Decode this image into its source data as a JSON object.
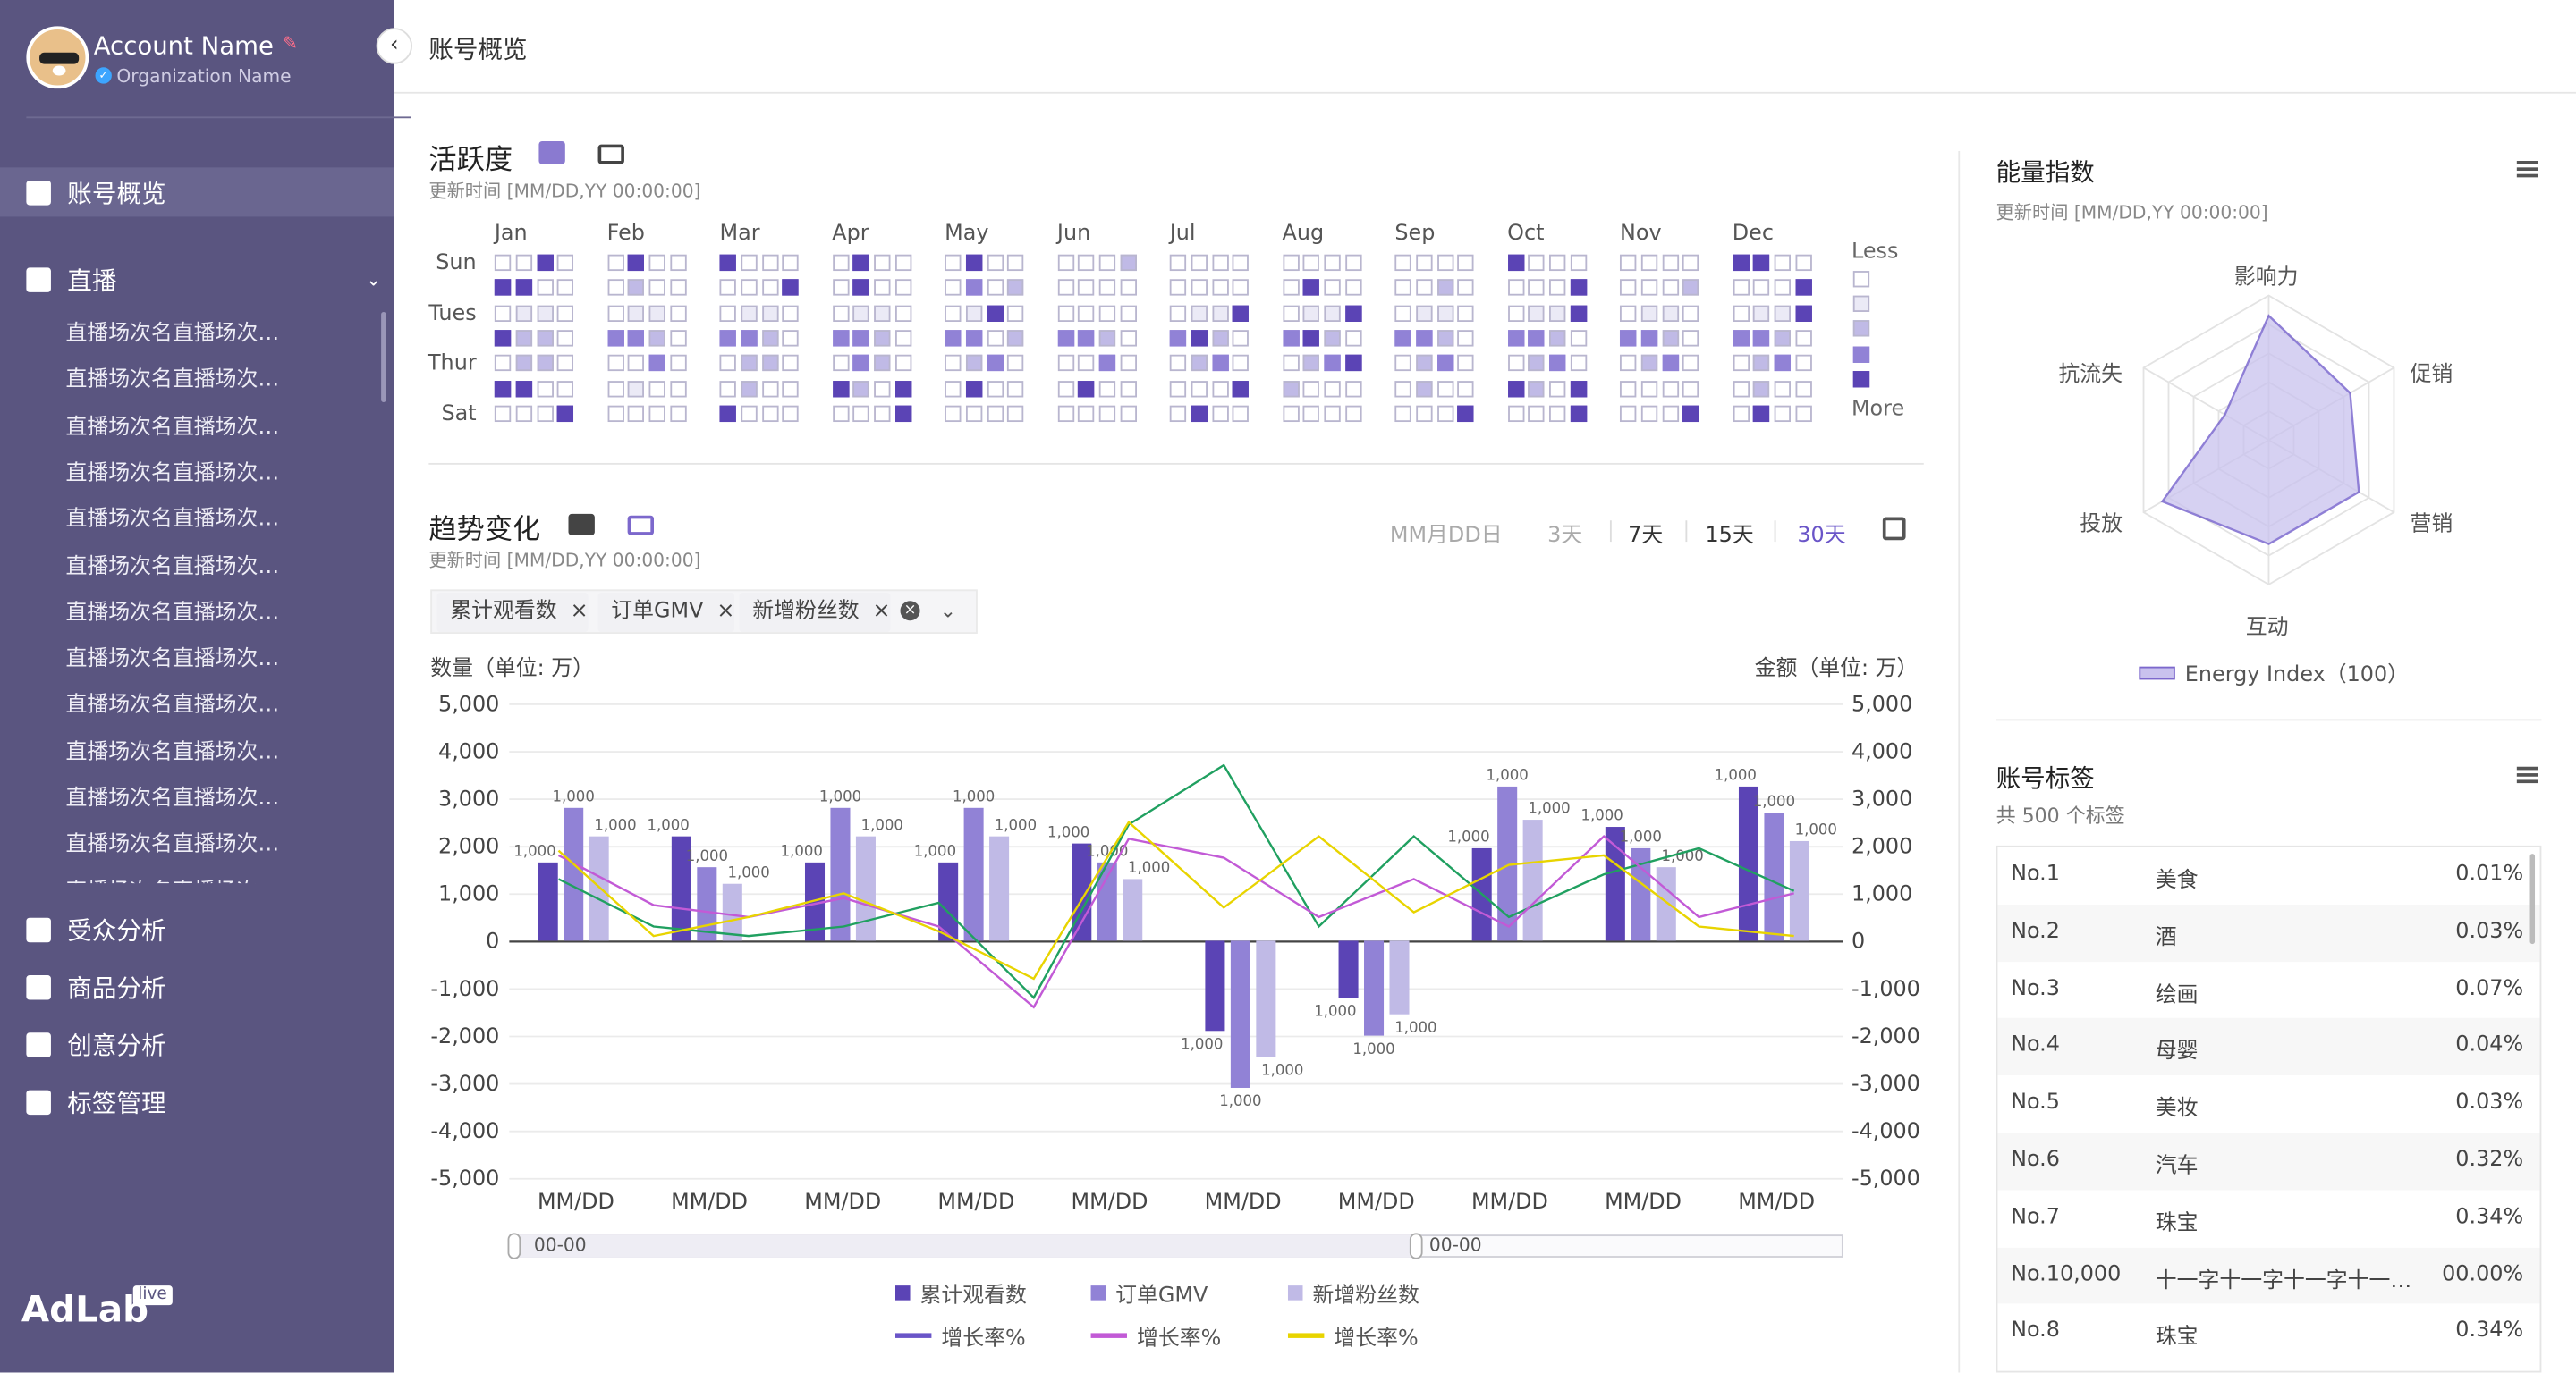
{
  "app": {
    "logo": "AdLab",
    "logo_badge": "live"
  },
  "account": {
    "name": "Account Name",
    "org": "Organization Name"
  },
  "header": {
    "title": "账号概览"
  },
  "nav": {
    "overview": "账号概览",
    "live": "直播",
    "live_items": [
      "直播场次名直播场次…",
      "直播场次名直播场次…",
      "直播场次名直播场次…",
      "直播场次名直播场次…",
      "直播场次名直播场次…",
      "直播场次名直播场次…",
      "直播场次名直播场次…",
      "直播场次名直播场次…",
      "直播场次名直播场次…",
      "直播场次名直播场次…",
      "直播场次名直播场次…",
      "直播场次名直播场次…",
      "直播场次名直播场次…"
    ],
    "audience": "受众分析",
    "product": "商品分析",
    "creative": "创意分析",
    "tags": "标签管理"
  },
  "activity": {
    "title": "活跃度",
    "updated": "更新时间 [MM/DD,YY 00:00:00]",
    "months": [
      "Jan",
      "Feb",
      "Mar",
      "Apr",
      "May",
      "Jun",
      "Jul",
      "Aug",
      "Sep",
      "Oct",
      "Nov",
      "Dec"
    ],
    "days": [
      "Sun",
      "Tues",
      "Thur",
      "Sat"
    ],
    "legend_less": "Less",
    "legend_more": "More",
    "level_colors": [
      "#ffffff",
      "#ebeaf6",
      "#c0bae6",
      "#9182d6",
      "#5b44b5"
    ],
    "levels": [
      [
        [
          0,
          0,
          4,
          0
        ],
        [
          4,
          4,
          0,
          0
        ],
        [
          0,
          1,
          1,
          0
        ],
        [
          4,
          2,
          2,
          0
        ],
        [
          0,
          2,
          2,
          0
        ],
        [
          4,
          4,
          0,
          0
        ],
        [
          0,
          0,
          0,
          4
        ]
      ],
      [
        [
          0,
          4,
          0,
          0
        ],
        [
          0,
          2,
          0,
          0
        ],
        [
          0,
          1,
          1,
          0
        ],
        [
          3,
          3,
          2,
          0
        ],
        [
          0,
          0,
          3,
          0
        ],
        [
          0,
          1,
          0,
          0
        ],
        [
          0,
          0,
          0,
          0
        ]
      ],
      [
        [
          4,
          0,
          0,
          0
        ],
        [
          0,
          0,
          0,
          4
        ],
        [
          0,
          1,
          1,
          0
        ],
        [
          3,
          3,
          2,
          0
        ],
        [
          0,
          2,
          2,
          0
        ],
        [
          0,
          2,
          0,
          0
        ],
        [
          4,
          0,
          0,
          0
        ]
      ],
      [
        [
          0,
          4,
          0,
          0
        ],
        [
          0,
          4,
          0,
          0
        ],
        [
          0,
          1,
          1,
          0
        ],
        [
          3,
          3,
          2,
          0
        ],
        [
          0,
          3,
          2,
          0
        ],
        [
          4,
          2,
          0,
          4
        ],
        [
          0,
          0,
          0,
          4
        ]
      ],
      [
        [
          0,
          4,
          0,
          0
        ],
        [
          0,
          3,
          0,
          2
        ],
        [
          0,
          1,
          4,
          0
        ],
        [
          3,
          3,
          0,
          2
        ],
        [
          0,
          2,
          3,
          0
        ],
        [
          0,
          4,
          0,
          0
        ],
        [
          0,
          0,
          0,
          0
        ]
      ],
      [
        [
          0,
          0,
          0,
          2
        ],
        [
          0,
          0,
          0,
          0
        ],
        [
          0,
          0,
          0,
          0
        ],
        [
          3,
          3,
          2,
          0
        ],
        [
          0,
          0,
          3,
          0
        ],
        [
          0,
          4,
          0,
          0
        ],
        [
          0,
          0,
          0,
          0
        ]
      ],
      [
        [
          0,
          0,
          0,
          0
        ],
        [
          0,
          0,
          0,
          0
        ],
        [
          0,
          1,
          1,
          4
        ],
        [
          3,
          4,
          2,
          0
        ],
        [
          0,
          2,
          3,
          0
        ],
        [
          0,
          0,
          0,
          4
        ],
        [
          0,
          4,
          0,
          0
        ]
      ],
      [
        [
          0,
          0,
          0,
          0
        ],
        [
          0,
          4,
          0,
          0
        ],
        [
          0,
          1,
          1,
          4
        ],
        [
          3,
          4,
          2,
          0
        ],
        [
          0,
          2,
          3,
          4
        ],
        [
          2,
          0,
          0,
          0
        ],
        [
          0,
          0,
          0,
          0
        ]
      ],
      [
        [
          0,
          0,
          0,
          0
        ],
        [
          0,
          0,
          2,
          0
        ],
        [
          0,
          1,
          1,
          0
        ],
        [
          3,
          3,
          2,
          0
        ],
        [
          0,
          2,
          3,
          0
        ],
        [
          0,
          2,
          0,
          0
        ],
        [
          0,
          0,
          0,
          4
        ]
      ],
      [
        [
          4,
          0,
          0,
          0
        ],
        [
          0,
          0,
          0,
          4
        ],
        [
          0,
          1,
          1,
          4
        ],
        [
          3,
          3,
          2,
          0
        ],
        [
          0,
          2,
          3,
          0
        ],
        [
          4,
          2,
          0,
          4
        ],
        [
          0,
          0,
          0,
          4
        ]
      ],
      [
        [
          0,
          0,
          0,
          0
        ],
        [
          0,
          0,
          0,
          2
        ],
        [
          0,
          1,
          1,
          0
        ],
        [
          3,
          3,
          2,
          0
        ],
        [
          0,
          2,
          3,
          0
        ],
        [
          0,
          0,
          0,
          0
        ],
        [
          0,
          0,
          0,
          4
        ]
      ],
      [
        [
          4,
          4,
          0,
          0
        ],
        [
          0,
          0,
          0,
          4
        ],
        [
          0,
          1,
          1,
          4
        ],
        [
          3,
          3,
          2,
          0
        ],
        [
          0,
          2,
          3,
          0
        ],
        [
          0,
          2,
          0,
          0
        ],
        [
          0,
          4,
          0,
          0
        ]
      ]
    ]
  },
  "trend": {
    "title": "趋势变化",
    "updated": "更新时间 [MM/DD,YY 00:00:00]",
    "date_placeholder": "MM月DD日",
    "ranges": [
      "3天",
      "7天",
      "15天",
      "30天"
    ],
    "active_range": "30天",
    "chips": [
      "累计观看数",
      "订单GMV",
      "新增粉丝数"
    ],
    "left_axis_label": "数量（单位: 万）",
    "right_axis_label": "金额（单位: 万）",
    "zoom_start": "00-00",
    "zoom_end": "00-00"
  },
  "chart_data": {
    "type": "bar",
    "categories": [
      "MM/DD",
      "MM/DD",
      "MM/DD",
      "MM/DD",
      "MM/DD",
      "MM/DD",
      "MM/DD",
      "MM/DD",
      "MM/DD",
      "MM/DD"
    ],
    "ylim": [
      -5000,
      5000
    ],
    "ticks": [
      "5,000",
      "4,000",
      "3,000",
      "2,000",
      "1,000",
      "0",
      "-1,000",
      "-2,000",
      "-3,000",
      "-4,000",
      "-5,000"
    ],
    "series": [
      {
        "name": "累计观看数",
        "type": "bar",
        "color": "#5b44b5",
        "values": [
          1650,
          2200,
          1650,
          1650,
          2050,
          -1900,
          -1200,
          1950,
          2400,
          3250
        ]
      },
      {
        "name": "订单GMV",
        "type": "bar",
        "color": "#9182d6",
        "values": [
          2800,
          1550,
          2800,
          2800,
          1650,
          -3100,
          -2000,
          3250,
          1950,
          2700
        ]
      },
      {
        "name": "新增粉丝数",
        "type": "bar",
        "color": "#c0bae6",
        "values": [
          2200,
          1200,
          2200,
          2200,
          1300,
          -2450,
          -1550,
          2550,
          1550,
          2100
        ]
      }
    ],
    "bar_label": "1,000",
    "lines": [
      {
        "name": "增长率%",
        "color": "#20a060",
        "values": [
          1300,
          300,
          100,
          300,
          800,
          -1200,
          2450,
          3700,
          300,
          2200,
          500,
          1400,
          1950,
          1050
        ]
      },
      {
        "name": "增长率%",
        "color": "#c25ad6",
        "values": [
          1800,
          750,
          500,
          900,
          300,
          -1400,
          2150,
          1750,
          500,
          1300,
          300,
          2200,
          500,
          1000
        ]
      },
      {
        "name": "增长率%",
        "color": "#e8d400",
        "values": [
          1900,
          100,
          500,
          1000,
          200,
          -800,
          2500,
          700,
          2200,
          600,
          1600,
          1800,
          300,
          100
        ]
      }
    ]
  },
  "energy": {
    "title": "能量指数",
    "updated": "更新时间 [MM/DD,YY 00:00:00]",
    "axes": [
      "影响力",
      "促销",
      "营销",
      "互动",
      "投放",
      "抗流失"
    ],
    "values": [
      0.86,
      0.65,
      0.72,
      0.72,
      0.85,
      0.35
    ],
    "legend": "Energy Index（100）"
  },
  "tags": {
    "title": "账号标签",
    "count": "共 500 个标签",
    "rows": [
      {
        "no": "No.1",
        "name": "美食",
        "pct": "0.01%"
      },
      {
        "no": "No.2",
        "name": "酒",
        "pct": "0.03%"
      },
      {
        "no": "No.3",
        "name": "绘画",
        "pct": "0.07%"
      },
      {
        "no": "No.4",
        "name": "母婴",
        "pct": "0.04%"
      },
      {
        "no": "No.5",
        "name": "美妆",
        "pct": "0.03%"
      },
      {
        "no": "No.6",
        "name": "汽车",
        "pct": "0.32%"
      },
      {
        "no": "No.7",
        "name": "珠宝",
        "pct": "0.34%"
      },
      {
        "no": "No.10,000",
        "name": "十一字十一字十一字十一字十一",
        "pct": "00.00%"
      },
      {
        "no": "No.8",
        "name": "珠宝",
        "pct": "0.34%"
      }
    ]
  }
}
